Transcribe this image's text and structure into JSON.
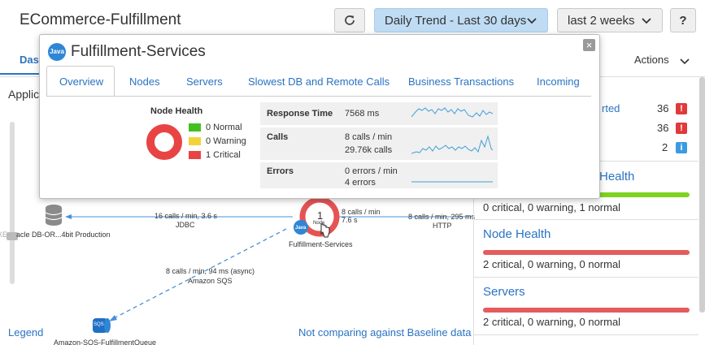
{
  "header": {
    "app_title": "ECommerce-Fulfillment",
    "trend_label": "Daily Trend - Last 30 days",
    "range_label": "last 2 weeks",
    "help_label": "?"
  },
  "page": {
    "tab_dashboard": "Das",
    "application_label": "Applica",
    "actions_label": "Actions",
    "legend_link": "Legend",
    "baseline_link": "Not comparing against Baseline data"
  },
  "flowmap": {
    "db_node_label": "acle DB-OR...4bit Production",
    "db_edge_calls": "16 calls / min, 3.6 s",
    "db_edge_type": "JDBC",
    "node_count": "1",
    "node_small": "Node",
    "node_calls": "8 calls / min",
    "node_time": "7.6 s",
    "node_name": "Fulfillment-Services",
    "http_edge_calls": "8 calls / min, 295 ms",
    "http_edge_type": "HTTP",
    "sqs_edge_calls": "8 calls / min, 94 ms (async)",
    "sqs_edge_type": "Amazon SQS",
    "sqs_badge": "SQS",
    "sqs_node_label": "Amazon-SQS-FulfillmentQueue",
    "left_edge_label": "XE-",
    "java_badge": "Java"
  },
  "right_panel": {
    "alerts": [
      {
        "label": "rted",
        "count": "36",
        "badge": "!"
      },
      {
        "count": "36",
        "badge": "!"
      },
      {
        "count": "2",
        "badge": "i"
      }
    ],
    "sections": [
      {
        "title": "Health",
        "summary": "0 critical, 0 warning, 1 normal",
        "bar_color": "#7ed321"
      },
      {
        "title": "Node Health",
        "summary": "2 critical, 0 warning, 0 normal",
        "bar_color": "#e45c5c"
      },
      {
        "title": "Servers",
        "summary": "2 critical, 0 warning, 0 normal",
        "bar_color": "#e45c5c"
      }
    ]
  },
  "popup": {
    "java_badge": "Java",
    "title": "Fulfillment-Services",
    "close_label": "×",
    "tabs": [
      "Overview",
      "Nodes",
      "Servers",
      "Slowest DB and Remote Calls",
      "Business Transactions",
      "Incoming"
    ],
    "node_health": {
      "title": "Node Health",
      "normal": "0 Normal",
      "warning": "0 Warning",
      "critical": "1 Critical",
      "colors": {
        "normal": "#44c01c",
        "warning": "#f3d33a",
        "critical": "#e84444"
      }
    },
    "stats": {
      "response_time_label": "Response Time",
      "response_time_value": "7568 ms",
      "calls_label": "Calls",
      "calls_rate": "8 calls / min",
      "calls_total": "29.76k calls",
      "errors_label": "Errors",
      "errors_rate": "0 errors / min",
      "errors_total": "4 errors"
    }
  }
}
